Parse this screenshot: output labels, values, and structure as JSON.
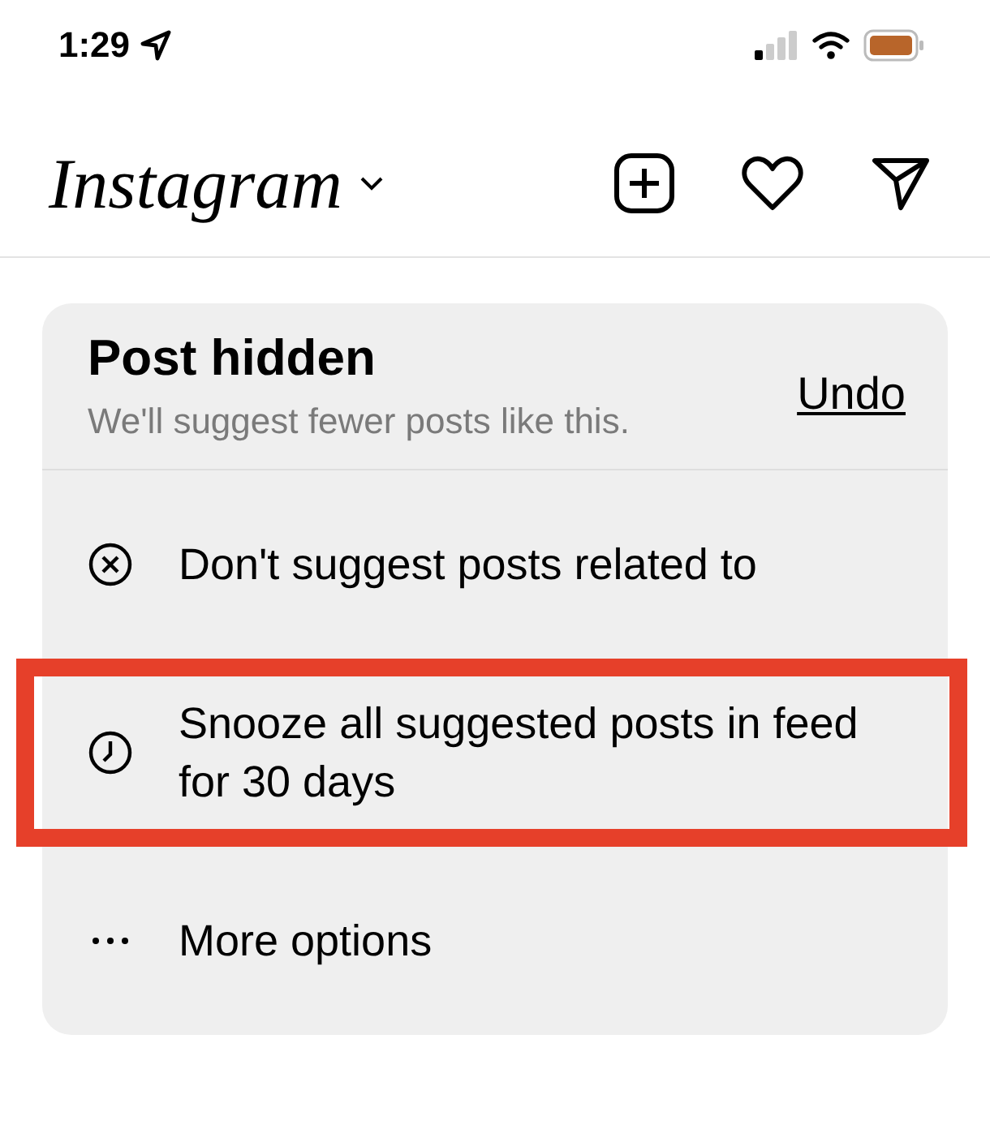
{
  "status_bar": {
    "time": "1:29"
  },
  "header": {
    "logo": "Instagram"
  },
  "card": {
    "title": "Post hidden",
    "subtitle": "We'll suggest fewer posts like this.",
    "undo": "Undo",
    "options": [
      {
        "kind": "close",
        "label": "Don't suggest posts related to",
        "highlighted": false
      },
      {
        "kind": "clock",
        "label": "Snooze all suggested posts in feed for 30 days",
        "highlighted": true
      },
      {
        "kind": "more",
        "label": "More options",
        "highlighted": false
      }
    ]
  }
}
